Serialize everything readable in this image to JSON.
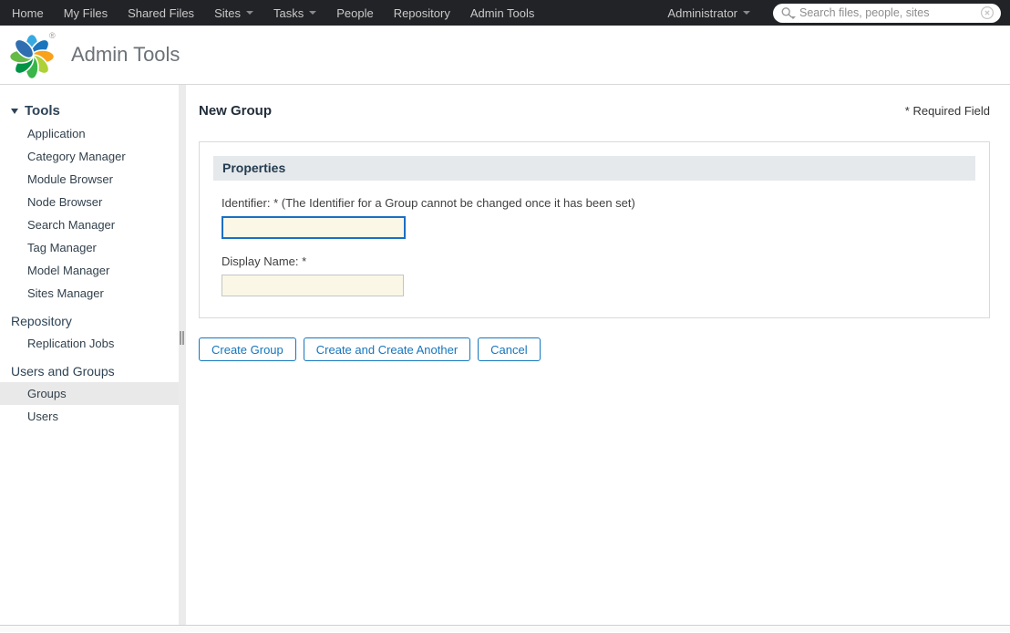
{
  "colors": {
    "nav_bg": "#222326",
    "accent_blue": "#1576bd",
    "focused_input_border": "#1a6fc4",
    "input_bg": "#faf7e6",
    "panel_header_bg": "#e5e9ec",
    "selected_item_bg": "#e9e9e9"
  },
  "nav": {
    "items": [
      {
        "label": "Home"
      },
      {
        "label": "My Files"
      },
      {
        "label": "Shared Files"
      },
      {
        "label": "Sites",
        "dropdown": true
      },
      {
        "label": "Tasks",
        "dropdown": true
      },
      {
        "label": "People"
      },
      {
        "label": "Repository"
      },
      {
        "label": "Admin Tools"
      }
    ],
    "user_menu": {
      "label": "Administrator"
    },
    "search": {
      "placeholder": "Search files, people, sites"
    }
  },
  "header": {
    "title": "Admin Tools"
  },
  "sidebar": {
    "sections": [
      {
        "label": "Tools",
        "items": [
          "Application",
          "Category Manager",
          "Module Browser",
          "Node Browser",
          "Search Manager",
          "Tag Manager",
          "Model Manager",
          "Sites Manager"
        ]
      },
      {
        "label": "Repository",
        "items": [
          "Replication Jobs"
        ]
      },
      {
        "label": "Users and Groups",
        "items": [
          "Groups",
          "Users"
        ],
        "selected": "Groups"
      }
    ]
  },
  "main": {
    "title": "New Group",
    "required_note": "* Required Field",
    "panel": {
      "header": "Properties",
      "fields": [
        {
          "label": "Identifier: * (The Identifier for a Group cannot be changed once it has been set)",
          "value": ""
        },
        {
          "label": "Display Name: *",
          "value": ""
        }
      ]
    },
    "buttons": [
      {
        "label": "Create Group"
      },
      {
        "label": "Create and Create Another"
      },
      {
        "label": "Cancel"
      }
    ]
  }
}
